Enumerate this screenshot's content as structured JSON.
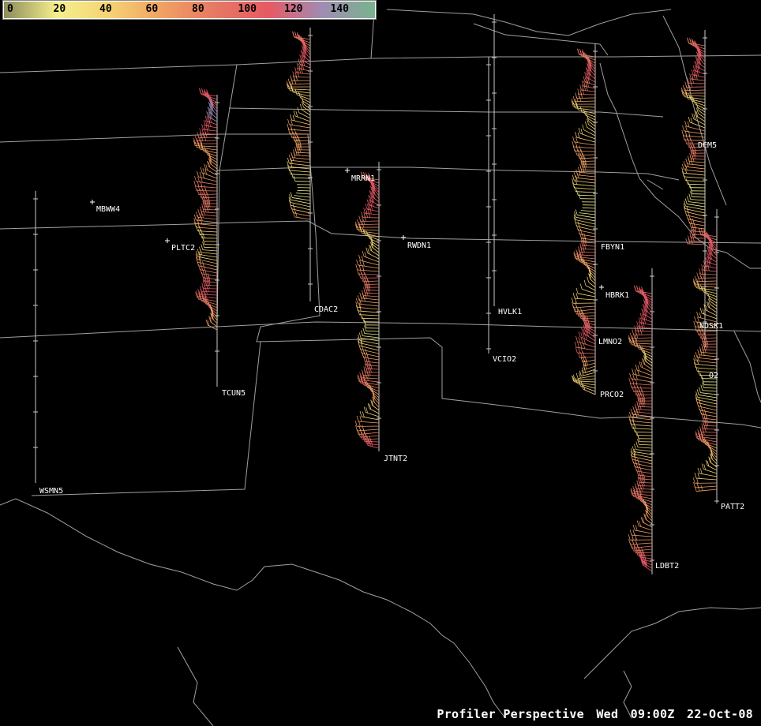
{
  "legend": {
    "ticks": [
      "0",
      "20",
      "40",
      "60",
      "80",
      "100",
      "120",
      "140"
    ],
    "colors": [
      "#8c8c5a",
      "#f5f08c",
      "#f5d273",
      "#f0a064",
      "#e67864",
      "#e65a64",
      "#a08cb4",
      "#78b48c"
    ]
  },
  "footer": {
    "product": "Profiler Perspective",
    "day": "Wed",
    "time": "09:00Z",
    "date": "22-Oct-08"
  },
  "stations": [
    {
      "id": "MBWW4",
      "speed_kt": null
    },
    {
      "id": "PLTC2",
      "speed_kt": 75
    },
    {
      "id": "TCUN5",
      "speed_kt": null
    },
    {
      "id": "WSMN5",
      "speed_kt": null
    },
    {
      "id": "CDAC2",
      "speed_kt": 55
    },
    {
      "id": "MRRN1",
      "speed_kt": 65
    },
    {
      "id": "JTNT2",
      "speed_kt": 60
    },
    {
      "id": "RWDN1",
      "speed_kt": null
    },
    {
      "id": "HVLK1",
      "speed_kt": null
    },
    {
      "id": "VCIO2",
      "speed_kt": null
    },
    {
      "id": "FBYN1",
      "speed_kt": 55
    },
    {
      "id": "HBRK1",
      "speed_kt": null
    },
    {
      "id": "LMNO2",
      "speed_kt": 50
    },
    {
      "id": "PRCO2",
      "speed_kt": 50
    },
    {
      "id": "DCM5",
      "speed_kt": 60
    },
    {
      "id": "NDSK1",
      "speed_kt": 60
    },
    {
      "id": "O2",
      "speed_kt": 55
    },
    {
      "id": "PATT2",
      "speed_kt": 30
    },
    {
      "id": "LDBT2",
      "speed_kt": 70
    }
  ]
}
